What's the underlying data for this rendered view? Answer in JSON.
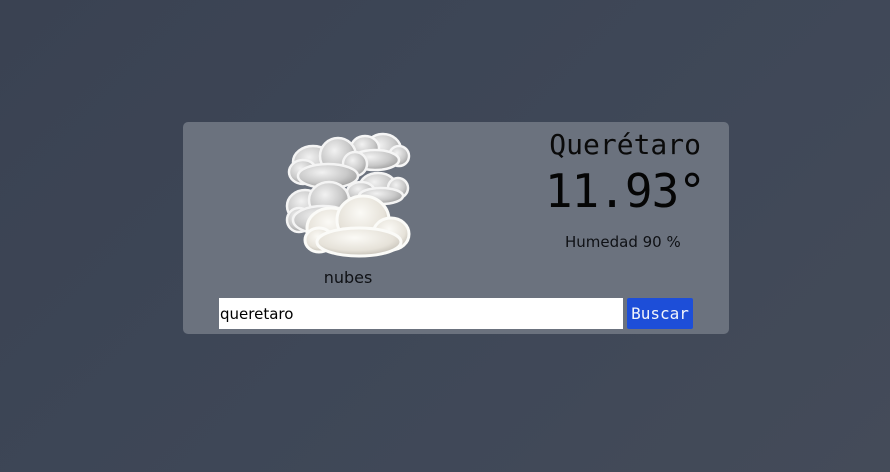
{
  "weather": {
    "icon": "clouds-icon",
    "description": "nubes",
    "city": "Querétaro",
    "temperature": "11.93°",
    "humidity_label": "Humedad 90 %"
  },
  "search": {
    "value": "queretaro",
    "placeholder": "",
    "button_label": "Buscar"
  },
  "colors": {
    "background": "#3e4757",
    "card": "#6b727e",
    "button": "#1d4ed8"
  }
}
